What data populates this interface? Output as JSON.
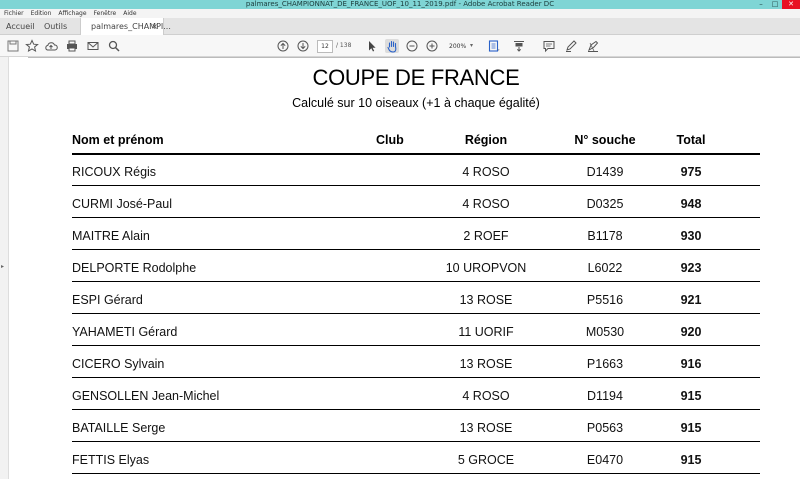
{
  "window": {
    "title": "palmares_CHAMPIONNAT_DE_FRANCE_UOF_10_11_2019.pdf - Adobe Acrobat Reader DC",
    "minimize": "–",
    "maximize": "□",
    "close": "✕"
  },
  "menu": [
    "Fichier",
    "Edition",
    "Affichage",
    "Fenêtre",
    "Aide"
  ],
  "tabs": {
    "home": "Accueil",
    "tools": "Outils",
    "document": "palmares_CHAMPI...",
    "document_close": "×"
  },
  "toolbar": {
    "current_page": "12",
    "total_pages": "/ 138",
    "zoom": "200%",
    "zoom_dropdown": "▾",
    "icons": [
      "save-icon",
      "star-icon",
      "cloud-upload-icon",
      "print-icon",
      "email-icon",
      "search-icon",
      "page-up-icon",
      "page-down-icon",
      "select-cursor-icon",
      "hand-icon",
      "zoom-out-icon",
      "zoom-in-icon",
      "page-fit-icon",
      "scroll-mode-icon",
      "comment-icon",
      "pen-icon",
      "sign-icon"
    ]
  },
  "document": {
    "title": "COUPE DE FRANCE",
    "subtitle": "Calculé sur 10 oiseaux (+1 à chaque égalité)",
    "columns": {
      "name": "Nom et prénom",
      "club": "Club",
      "region": "Région",
      "souche": "N° souche",
      "total": "Total"
    },
    "rows": [
      {
        "name": "RICOUX Régis",
        "club": "",
        "region": "4 ROSO",
        "souche": "D1439",
        "total": "975"
      },
      {
        "name": "CURMI José-Paul",
        "club": "",
        "region": "4 ROSO",
        "souche": "D0325",
        "total": "948"
      },
      {
        "name": "MAITRE Alain",
        "club": "",
        "region": "2 ROEF",
        "souche": "B1178",
        "total": "930"
      },
      {
        "name": "DELPORTE Rodolphe",
        "club": "",
        "region": "10 UROPVON",
        "souche": "L6022",
        "total": "923"
      },
      {
        "name": "ESPI Gérard",
        "club": "",
        "region": "13 ROSE",
        "souche": "P5516",
        "total": "921"
      },
      {
        "name": "YAHAMETI Gérard",
        "club": "",
        "region": "11 UORIF",
        "souche": "M0530",
        "total": "920"
      },
      {
        "name": "CICERO Sylvain",
        "club": "",
        "region": "13 ROSE",
        "souche": "P1663",
        "total": "916"
      },
      {
        "name": "GENSOLLEN Jean-Michel",
        "club": "",
        "region": "4 ROSO",
        "souche": "D1194",
        "total": "915"
      },
      {
        "name": "BATAILLE Serge",
        "club": "",
        "region": "13 ROSE",
        "souche": "P0563",
        "total": "915"
      },
      {
        "name": "FETTIS Elyas",
        "club": "",
        "region": "5 GROCE",
        "souche": "E0470",
        "total": "915"
      }
    ]
  },
  "colors": {
    "titlebar": "#7fd5d5",
    "close_button": "#e81123"
  }
}
